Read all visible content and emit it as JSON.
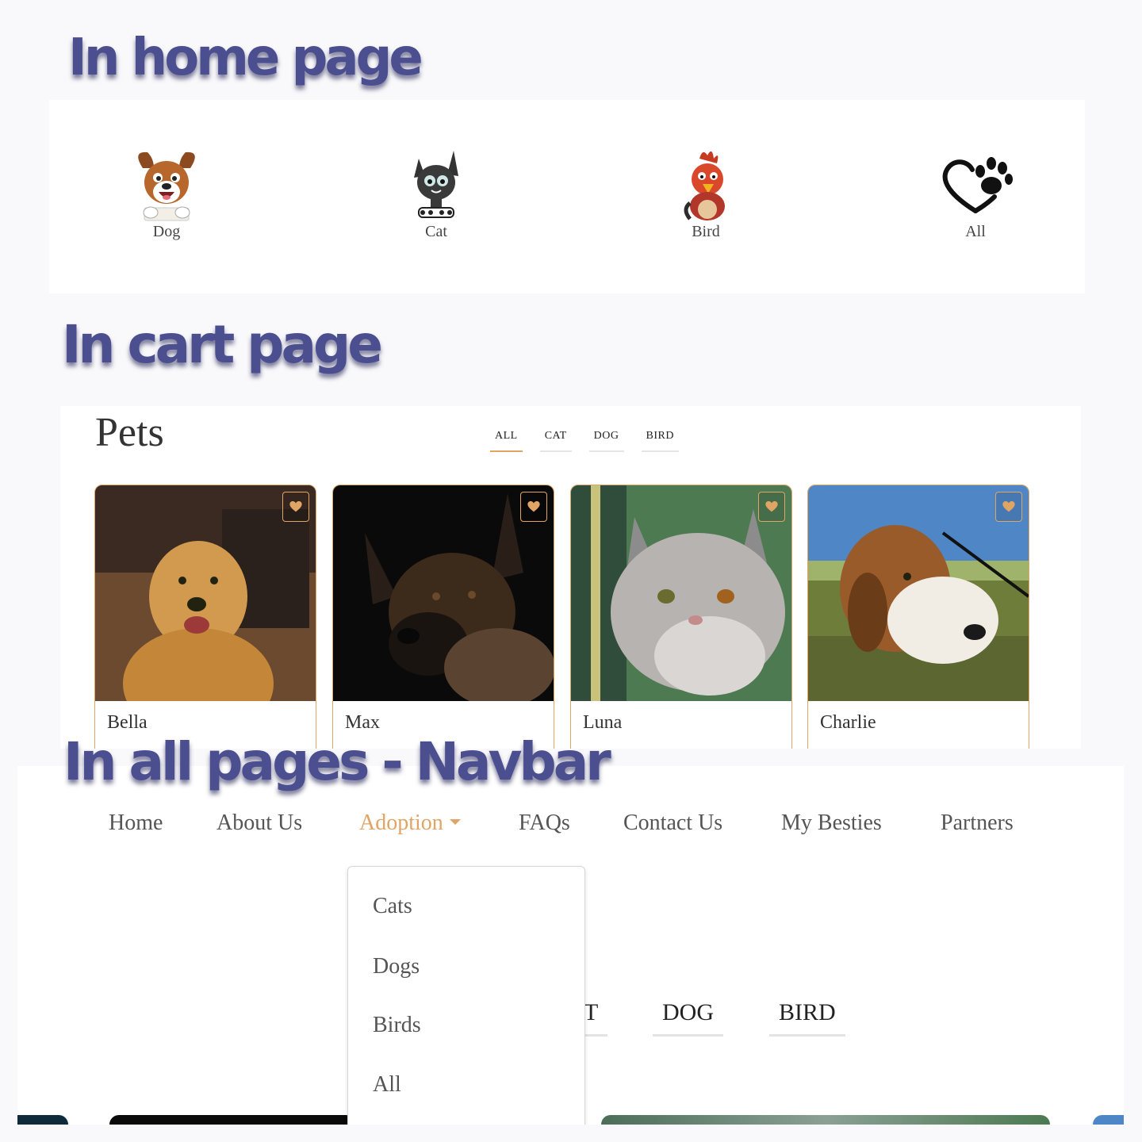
{
  "headings": {
    "home": "In home page",
    "cart": "In cart page",
    "navbar": "In all pages - Navbar"
  },
  "home_categories": [
    {
      "label": "Dog",
      "icon": "dog-icon"
    },
    {
      "label": "Cat",
      "icon": "cat-icon"
    },
    {
      "label": "Bird",
      "icon": "bird-icon"
    },
    {
      "label": "All",
      "icon": "heart-paw-icon"
    }
  ],
  "cart": {
    "title": "Pets",
    "filters": [
      "ALL",
      "CAT",
      "DOG",
      "BIRD"
    ],
    "active_filter": "ALL",
    "cards": [
      {
        "name": "Bella"
      },
      {
        "name": "Max"
      },
      {
        "name": "Luna"
      },
      {
        "name": "Charlie"
      }
    ]
  },
  "navbar": {
    "items": [
      "Home",
      "About Us",
      "Adoption",
      "FAQs",
      "Contact Us",
      "My Besties",
      "Partners"
    ],
    "active": "Adoption",
    "dropdown": [
      "Cats",
      "Dogs",
      "Birds",
      "All"
    ],
    "background_filters": [
      "T",
      "DOG",
      "BIRD"
    ]
  },
  "colors": {
    "accent": "#e0a465",
    "heading": "#4c4f8f",
    "text": "#555555"
  }
}
